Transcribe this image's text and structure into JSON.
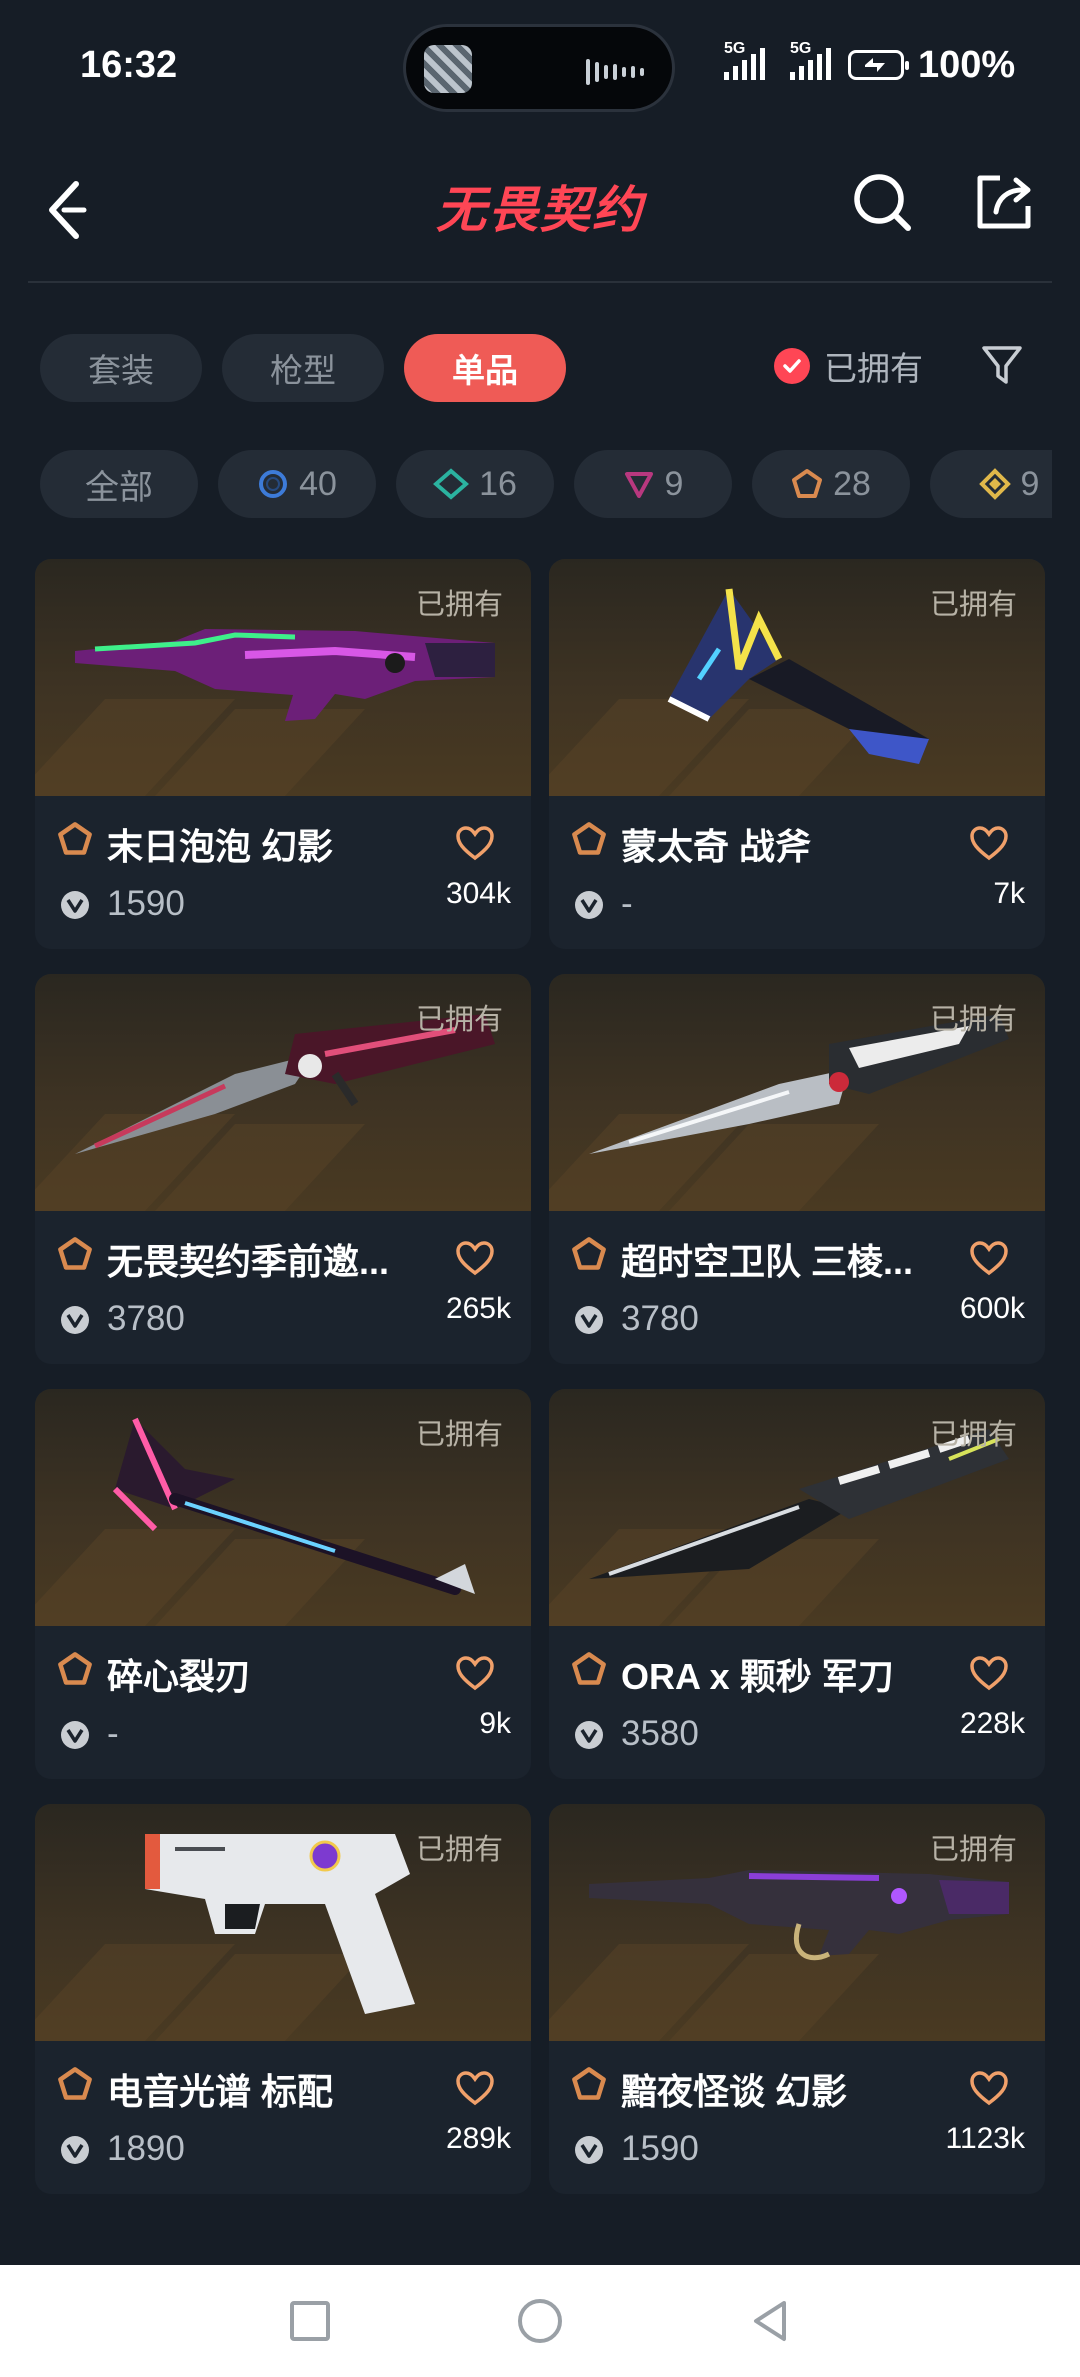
{
  "status": {
    "time": "16:32",
    "net1": "5G",
    "net2": "5G",
    "battery": "100%"
  },
  "header": {
    "title": "无畏契约"
  },
  "tabs": [
    {
      "label": "套装",
      "active": false
    },
    {
      "label": "枪型",
      "active": false
    },
    {
      "label": "单品",
      "active": true
    }
  ],
  "owned_filter": {
    "label": "已拥有",
    "checked": true
  },
  "tiers": [
    {
      "label": "全部",
      "icon": "all"
    },
    {
      "label": "40",
      "icon": "select-tier-icon",
      "color": "#3d7bd8"
    },
    {
      "label": "16",
      "icon": "deluxe-tier-icon",
      "color": "#2bb3a0"
    },
    {
      "label": "9",
      "icon": "premium-tier-icon",
      "color": "#b8387f"
    },
    {
      "label": "28",
      "icon": "exclusive-tier-icon",
      "color": "#d98a4f"
    },
    {
      "label": "9",
      "icon": "ultra-tier-icon",
      "color": "#e0b84a"
    }
  ],
  "items": [
    {
      "owned": "已拥有",
      "name": "末日泡泡 幻影",
      "price": "1590",
      "likes": "304k",
      "weapon": "rifle-purple"
    },
    {
      "owned": "已拥有",
      "name": "蒙太奇 战斧",
      "price": "-",
      "likes": "7k",
      "weapon": "axe"
    },
    {
      "owned": "已拥有",
      "name": "无畏契约季前邀...",
      "price": "3780",
      "likes": "265k",
      "weapon": "knife-red"
    },
    {
      "owned": "已拥有",
      "name": "超时空卫队 三棱...",
      "price": "3780",
      "likes": "600k",
      "weapon": "knife-silver"
    },
    {
      "owned": "已拥有",
      "name": "碎心裂刃",
      "price": "-",
      "likes": "9k",
      "weapon": "spear"
    },
    {
      "owned": "已拥有",
      "name": "ORA x 颗秒 军刀",
      "price": "3580",
      "likes": "228k",
      "weapon": "blade-dark"
    },
    {
      "owned": "已拥有",
      "name": "电音光谱 标配",
      "price": "1890",
      "likes": "289k",
      "weapon": "pistol-white"
    },
    {
      "owned": "已拥有",
      "name": "黯夜怪谈 幻影",
      "price": "1590",
      "likes": "1123k",
      "weapon": "rifle-dark"
    }
  ],
  "colors": {
    "accent": "#ff4655",
    "tab_active": "#ef5b56",
    "tier_exclusive": "#d98a4f",
    "heart": "#f0a06a"
  }
}
